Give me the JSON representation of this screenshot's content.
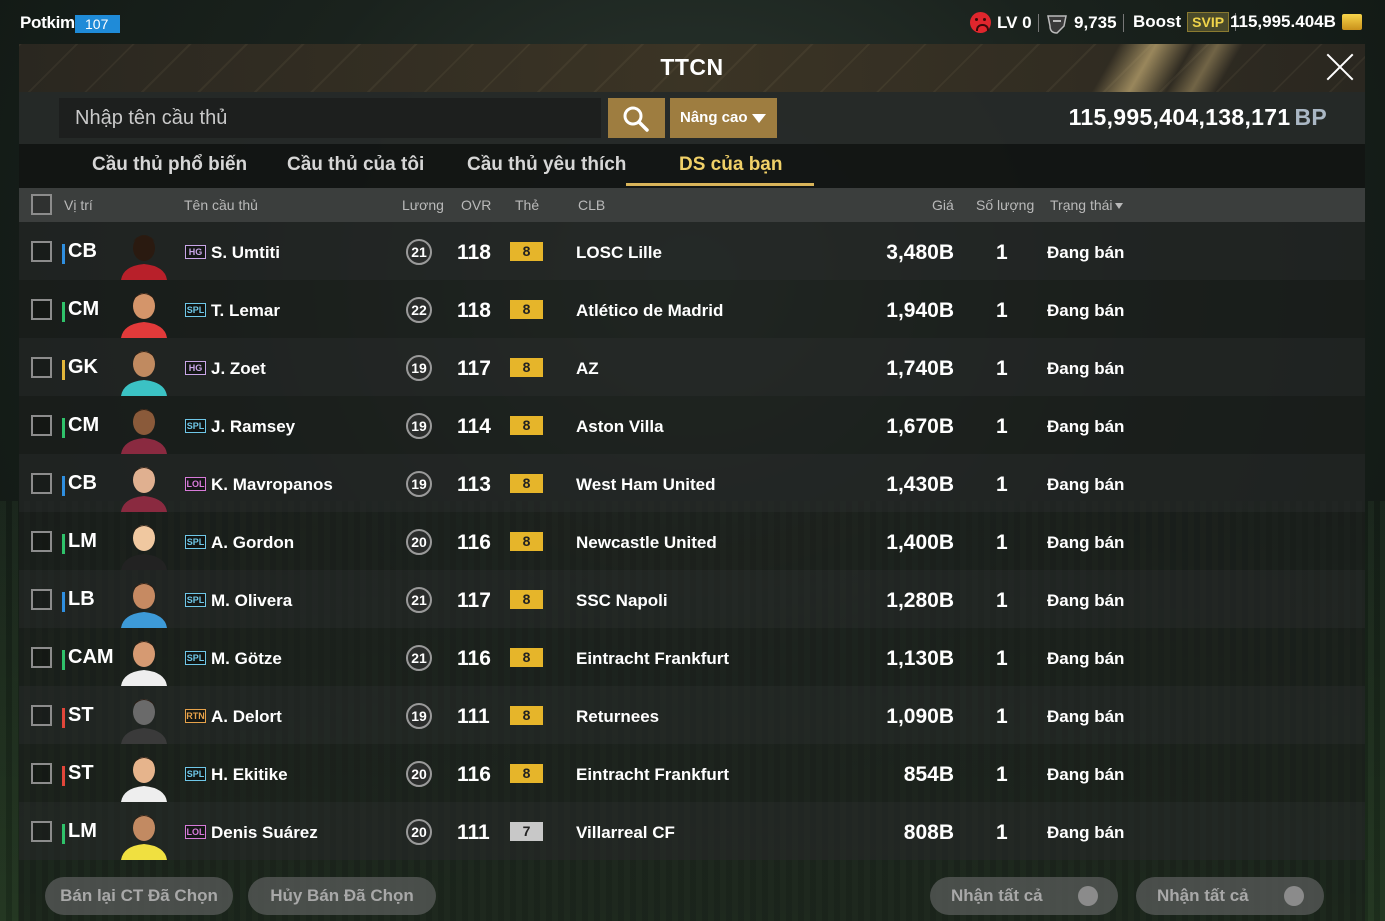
{
  "user": {
    "name": "Potkim",
    "level": "107"
  },
  "status": {
    "lv": "LV 0",
    "points": "9,735",
    "boost_label": "Boost",
    "svip": "SVIP",
    "coins": "115,995.404B"
  },
  "panel": {
    "title": "TTCN"
  },
  "search": {
    "placeholder": "Nhập tên cầu thủ",
    "advanced_label": "Nâng cao"
  },
  "balance": {
    "value": "115,995,404,138,171",
    "unit": "BP"
  },
  "tabs": [
    "Cầu thủ phổ biến",
    "Cầu thủ của tôi",
    "Cầu thủ yêu thích",
    "DS của bạn"
  ],
  "active_tab": "DS của bạn",
  "columns": {
    "pos": "Vị trí",
    "name": "Tên cầu thủ",
    "wage": "Lương",
    "ovr": "OVR",
    "grade": "Thẻ",
    "club": "CLB",
    "price": "Giá",
    "qty": "Số lượng",
    "status": "Trạng thái"
  },
  "rows": [
    {
      "pos": "CB",
      "season": "HG",
      "name": "S. Umtiti",
      "wage": "21",
      "ovr": "118",
      "grade": "8",
      "club": "LOSC Lille",
      "price": "3,480B",
      "qty": "1",
      "status": "Đang bán"
    },
    {
      "pos": "CM",
      "season": "SPL",
      "name": "T. Lemar",
      "wage": "22",
      "ovr": "118",
      "grade": "8",
      "club": "Atlético de Madrid",
      "price": "1,940B",
      "qty": "1",
      "status": "Đang bán"
    },
    {
      "pos": "GK",
      "season": "HG",
      "name": "J. Zoet",
      "wage": "19",
      "ovr": "117",
      "grade": "8",
      "club": "AZ",
      "price": "1,740B",
      "qty": "1",
      "status": "Đang bán"
    },
    {
      "pos": "CM",
      "season": "SPL",
      "name": "J. Ramsey",
      "wage": "19",
      "ovr": "114",
      "grade": "8",
      "club": "Aston Villa",
      "price": "1,670B",
      "qty": "1",
      "status": "Đang bán"
    },
    {
      "pos": "CB",
      "season": "LOL",
      "name": "K. Mavropanos",
      "wage": "19",
      "ovr": "113",
      "grade": "8",
      "club": "West Ham United",
      "price": "1,430B",
      "qty": "1",
      "status": "Đang bán"
    },
    {
      "pos": "LM",
      "season": "SPL",
      "name": "A. Gordon",
      "wage": "20",
      "ovr": "116",
      "grade": "8",
      "club": "Newcastle United",
      "price": "1,400B",
      "qty": "1",
      "status": "Đang bán"
    },
    {
      "pos": "LB",
      "season": "SPL",
      "name": "M. Olivera",
      "wage": "21",
      "ovr": "117",
      "grade": "8",
      "club": "SSC Napoli",
      "price": "1,280B",
      "qty": "1",
      "status": "Đang bán"
    },
    {
      "pos": "CAM",
      "season": "SPL",
      "name": "M. Götze",
      "wage": "21",
      "ovr": "116",
      "grade": "8",
      "club": "Eintracht Frankfurt",
      "price": "1,130B",
      "qty": "1",
      "status": "Đang bán"
    },
    {
      "pos": "ST",
      "season": "RTN",
      "name": "A. Delort",
      "wage": "19",
      "ovr": "111",
      "grade": "8",
      "club": "Returnees",
      "price": "1,090B",
      "qty": "1",
      "status": "Đang bán"
    },
    {
      "pos": "ST",
      "season": "SPL",
      "name": "H. Ekitike",
      "wage": "20",
      "ovr": "116",
      "grade": "8",
      "club": "Eintracht Frankfurt",
      "price": "854B",
      "qty": "1",
      "status": "Đang bán"
    },
    {
      "pos": "LM",
      "season": "LOL",
      "name": "Denis Suárez",
      "wage": "20",
      "ovr": "111",
      "grade": "7",
      "club": "Villarreal CF",
      "price": "808B",
      "qty": "1",
      "status": "Đang bán"
    }
  ],
  "footer": {
    "resell": "Bán lại CT Đã Chọn",
    "cancel": "Hủy Bán Đã Chọn",
    "claim_all_1": "Nhận tất cả",
    "claim_all_2": "Nhận tất cả"
  },
  "colors": {
    "def": "#2f8fe0",
    "mid": "#2fc26a",
    "gk": "#e2b63a",
    "att": "#e2463a",
    "grade8": "#e6b52a",
    "grade7": "#c8c8c8",
    "gold_btn": "#9e7d40"
  }
}
